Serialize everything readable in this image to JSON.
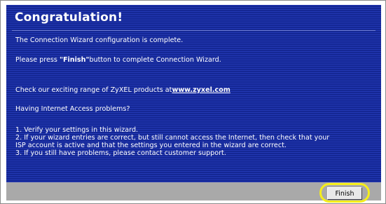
{
  "panel": {
    "title": "Congratulation!",
    "complete_text": "The Connection Wizard configuration is complete.",
    "press_prefix": "Please press ",
    "press_finish_word": "\"Finish\"",
    "press_suffix": "button to complete Connection Wizard.",
    "products_prefix": "Check our exciting range of ZyXEL products at",
    "products_link": "www.zyxel.com",
    "problems_heading": "Having Internet Access problems?",
    "tips": [
      "1. Verify your settings in this wizard.",
      "2. If your wizard entries are correct, but still cannot access the Internet, then check that your",
      "ISP account is active and that the settings you entered in the wizard are correct.",
      "3. If you still have problems, please contact customer support."
    ]
  },
  "footer": {
    "finish_label": "Finish"
  },
  "colors": {
    "panel_blue": "#1a2fa0",
    "footer_gray": "#a9a9a9",
    "highlight_yellow": "#f5ee1b"
  }
}
